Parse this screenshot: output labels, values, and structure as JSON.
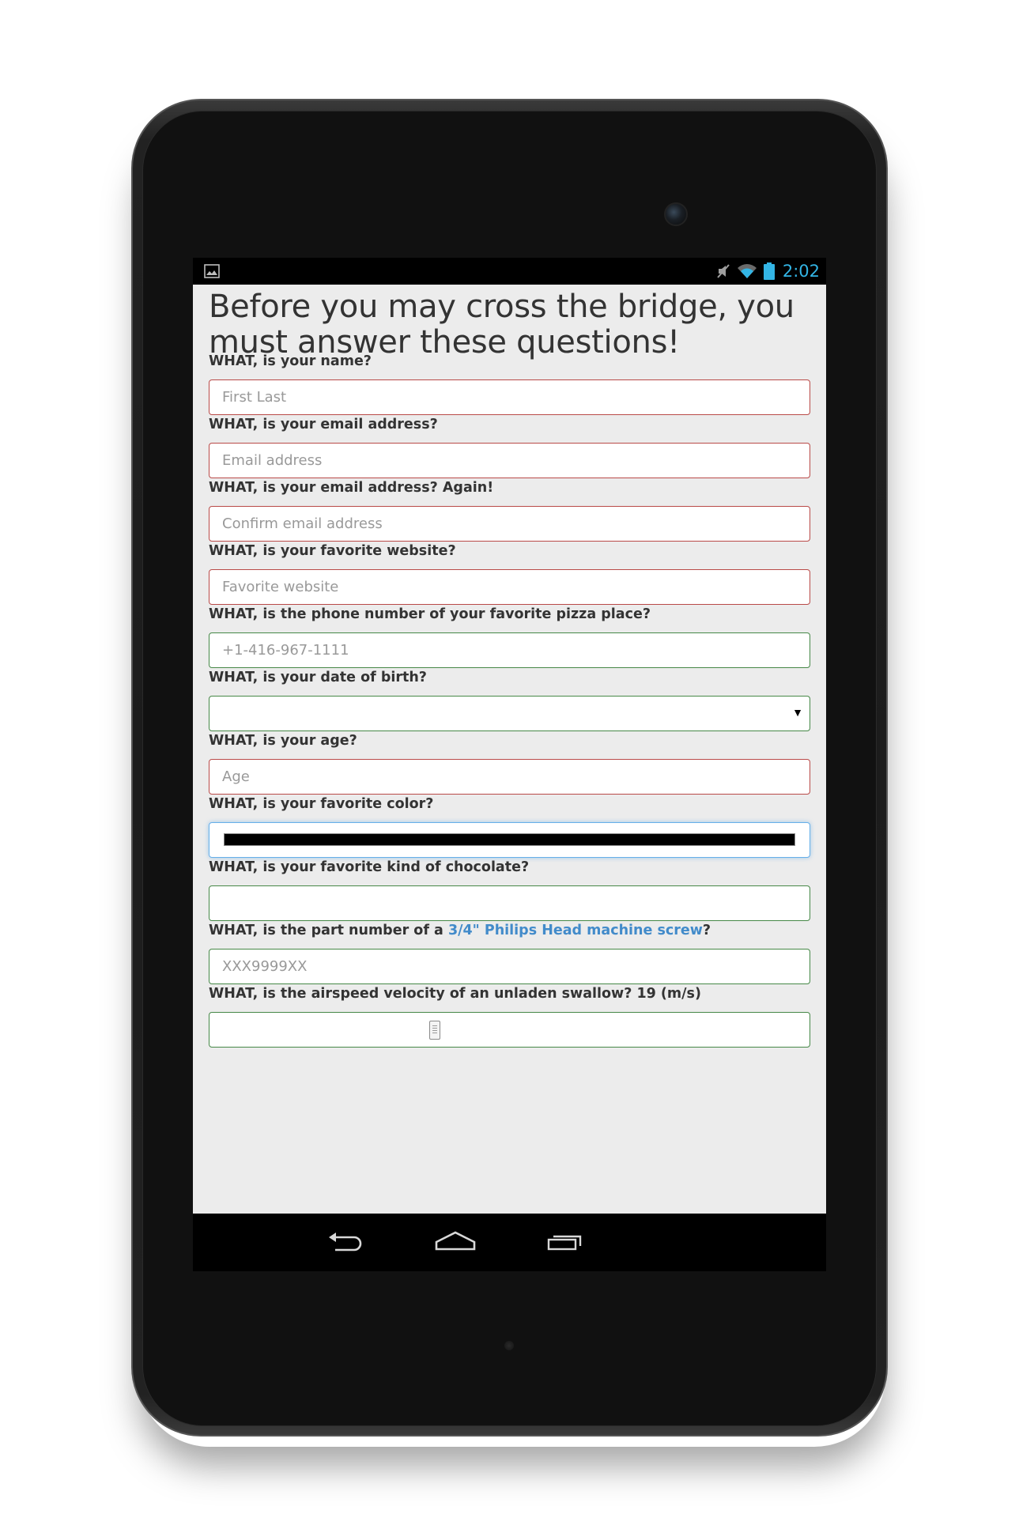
{
  "status_bar": {
    "time": "2:02",
    "icons": [
      "image-notification-icon",
      "mute-icon",
      "wifi-icon",
      "battery-icon"
    ],
    "time_color": "#33b5e5"
  },
  "page": {
    "title": "Before you may cross the bridge, you must answer these questions!"
  },
  "form": {
    "name": {
      "label": "WHAT, is your name?",
      "placeholder": "First Last",
      "state": "invalid"
    },
    "email": {
      "label": "WHAT, is your email address?",
      "placeholder": "Email address",
      "state": "invalid"
    },
    "email_confirm": {
      "label": "WHAT, is your email address? Again!",
      "placeholder": "Confirm email address",
      "state": "invalid"
    },
    "website": {
      "label": "WHAT, is your favorite website?",
      "placeholder": "Favorite website",
      "state": "invalid"
    },
    "phone": {
      "label": "WHAT, is the phone number of your favorite pizza place?",
      "placeholder": "+1-416-967-1111",
      "state": "valid"
    },
    "dob": {
      "label": "WHAT, is your date of birth?",
      "value": "",
      "arrow": "▼",
      "state": "valid"
    },
    "age": {
      "label": "WHAT, is your age?",
      "placeholder": "Age",
      "state": "invalid"
    },
    "color": {
      "label": "WHAT, is your favorite color?",
      "value_color": "#000000",
      "state": "focused"
    },
    "chocolate": {
      "label": "WHAT, is your favorite kind of chocolate?",
      "value": "",
      "state": "valid"
    },
    "part_number": {
      "label_prefix": "WHAT, is the part number of a ",
      "label_link": "3/4\" Philips Head machine screw",
      "label_suffix": "?",
      "placeholder": "XXX9999XX",
      "state": "valid"
    },
    "airspeed": {
      "label": "WHAT, is the airspeed velocity of an unladen swallow? 19 (m/s)",
      "value": 19,
      "state": "valid"
    }
  },
  "colors": {
    "invalid_border": "#b94a48",
    "valid_border": "#468847",
    "focus_border": "#66afe9",
    "link": "#428bca",
    "page_bg": "#ececec"
  },
  "nav_bar": {
    "buttons": [
      "back-icon",
      "home-icon",
      "recent-apps-icon"
    ]
  }
}
